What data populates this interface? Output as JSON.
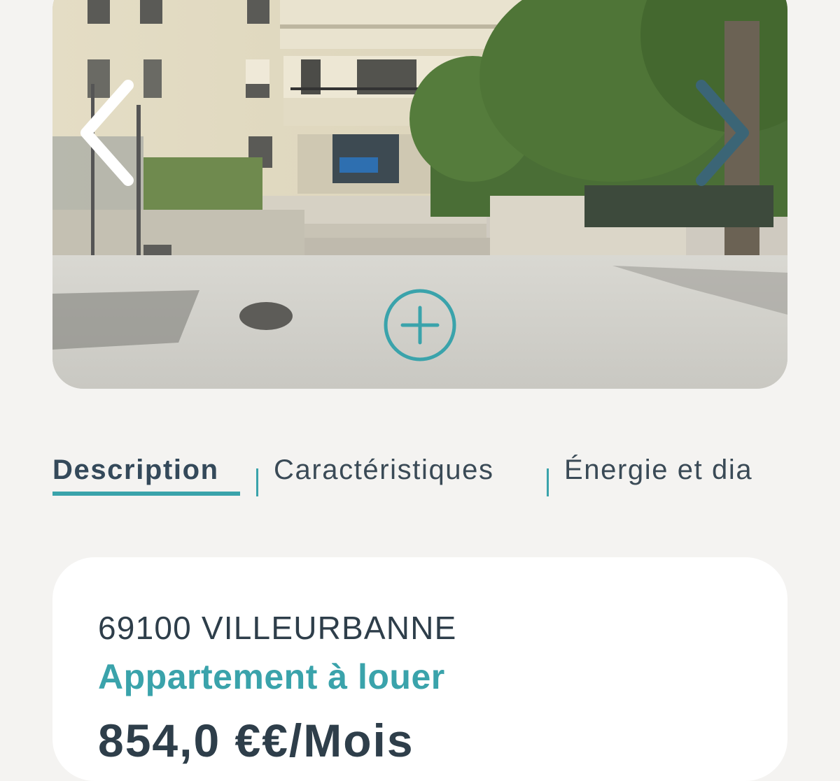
{
  "gallery": {
    "photo_alt": "Façade de l'immeuble",
    "prev_icon": "chevron-left-icon",
    "next_icon": "chevron-right-icon",
    "zoom_icon": "plus-circle-icon"
  },
  "tabs": [
    {
      "label": "Description",
      "active": true
    },
    {
      "label": "Caractéristiques",
      "active": false
    },
    {
      "label": "Énergie et dia",
      "active": false
    }
  ],
  "listing": {
    "location": "69100 VILLEURBANNE",
    "type": "Appartement à louer",
    "price": "854,0 €€/Mois"
  },
  "colors": {
    "accent": "#3aa3ab",
    "text_dark": "#2e3e4a",
    "background": "#f4f3f1"
  }
}
